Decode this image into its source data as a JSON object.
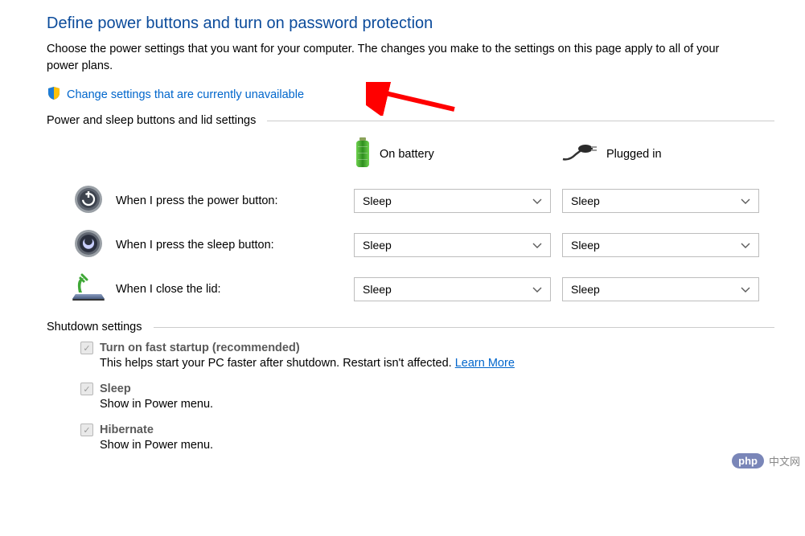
{
  "title": "Define power buttons and turn on password protection",
  "description": "Choose the power settings that you want for your computer. The changes you make to the settings on this page apply to all of your power plans.",
  "change_settings_link": "Change settings that are currently unavailable",
  "section1_title": "Power and sleep buttons and lid settings",
  "columns": {
    "battery": "On battery",
    "plugged": "Plugged in"
  },
  "rows": [
    {
      "label": "When I press the power button:",
      "battery": "Sleep",
      "plugged": "Sleep"
    },
    {
      "label": "When I press the sleep button:",
      "battery": "Sleep",
      "plugged": "Sleep"
    },
    {
      "label": "When I close the lid:",
      "battery": "Sleep",
      "plugged": "Sleep"
    }
  ],
  "section2_title": "Shutdown settings",
  "shutdown": {
    "fast_startup": {
      "label": "Turn on fast startup (recommended)",
      "desc_pre": "This helps start your PC faster after shutdown. Restart isn't affected. ",
      "learn_more": "Learn More"
    },
    "sleep": {
      "label": "Sleep",
      "desc": "Show in Power menu."
    },
    "hibernate": {
      "label": "Hibernate",
      "desc": "Show in Power menu."
    }
  },
  "watermark": {
    "badge": "php",
    "text": "中文网"
  }
}
